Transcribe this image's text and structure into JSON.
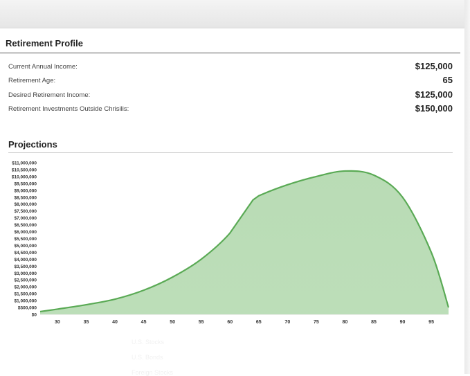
{
  "profile": {
    "title": "Retirement Profile",
    "rows": [
      {
        "label": "Current Annual Income:",
        "value": "$125,000"
      },
      {
        "label": "Retirement Age:",
        "value": "65"
      },
      {
        "label": "Desired Retirement Income:",
        "value": "$125,000"
      },
      {
        "label": "Retirement Investments Outside Chrisilis:",
        "value": "$150,000"
      }
    ]
  },
  "projections": {
    "title": "Projections"
  },
  "ghost_labels": [
    "U.S. Stocks",
    "U.S. Bonds",
    "Foreign Stocks"
  ],
  "colors": {
    "fill": "#b9dcb5",
    "line": "#5aaa55",
    "tick_text": "#333333"
  },
  "chart_data": {
    "type": "area",
    "title": "",
    "xlabel": "",
    "ylabel": "",
    "xlim": [
      27,
      98
    ],
    "ylim": [
      0,
      11000000
    ],
    "grid": false,
    "x_ticks": [
      30,
      35,
      40,
      45,
      50,
      55,
      60,
      65,
      70,
      75,
      80,
      85,
      90,
      95
    ],
    "y_tick_values": [
      0,
      500000,
      1000000,
      1500000,
      2000000,
      2500000,
      3000000,
      3500000,
      4000000,
      4500000,
      5000000,
      5500000,
      6000000,
      6500000,
      7000000,
      7500000,
      8000000,
      8500000,
      9000000,
      9500000,
      10000000,
      10500000,
      11000000
    ],
    "y_tick_labels": [
      "$0",
      "$500,000",
      "$1,000,000",
      "$1,500,000",
      "$2,000,000",
      "$2,500,000",
      "$3,000,000",
      "$3,500,000",
      "$4,000,000",
      "$4,500,000",
      "$5,000,000",
      "$5,500,000",
      "$6,000,000",
      "$6,500,000",
      "$7,000,000",
      "$7,500,000",
      "$8,000,000",
      "$8,500,000",
      "$9,000,000",
      "$9,500,000",
      "$10,000,000",
      "$10,500,000",
      "$11,000,000"
    ],
    "series": [
      {
        "x": [
          27,
          30,
          35,
          40,
          45,
          50,
          55,
          60,
          64,
          65,
          70,
          75,
          80,
          85,
          90,
          95,
          98
        ],
        "values": [
          200000,
          380000,
          700000,
          1100000,
          1750000,
          2700000,
          4000000,
          5900000,
          8300000,
          8600000,
          9400000,
          10000000,
          10400000,
          10100000,
          8500000,
          4500000,
          500000
        ]
      }
    ]
  }
}
